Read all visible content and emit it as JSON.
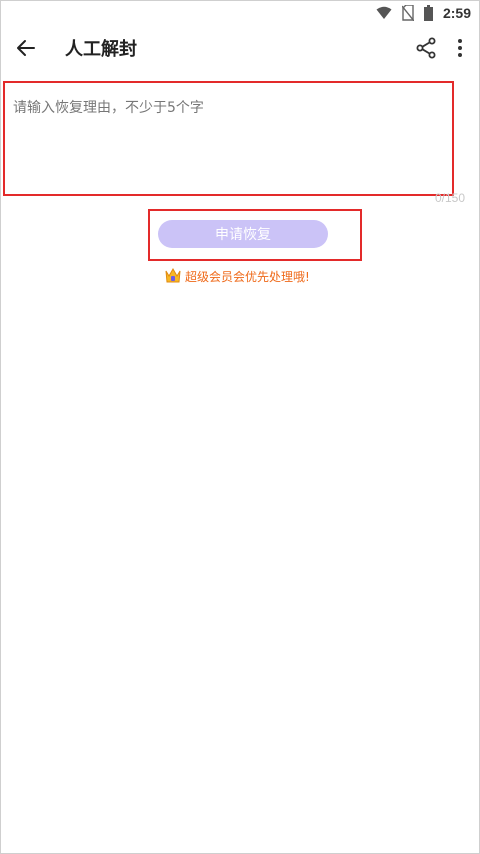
{
  "status_bar": {
    "time": "2:59",
    "icons": [
      "wifi-icon",
      "sim-off-icon",
      "battery-icon"
    ]
  },
  "app_bar": {
    "title": "人工解封",
    "icons": [
      "back-arrow-icon",
      "share-icon",
      "more-vert-icon"
    ]
  },
  "form": {
    "reason_placeholder": "请输入恢复理由，不少于5个字",
    "reason_value": "",
    "char_counter": "0/150",
    "submit_label": "申请恢复"
  },
  "vip_note": {
    "text": "超级会员会优先处理哦!",
    "icon": "crown-badge-icon"
  },
  "colors": {
    "submit_bg": "#cbc3f7",
    "highlight_border": "#e32a2a",
    "vip_text": "#ef6a1a"
  }
}
